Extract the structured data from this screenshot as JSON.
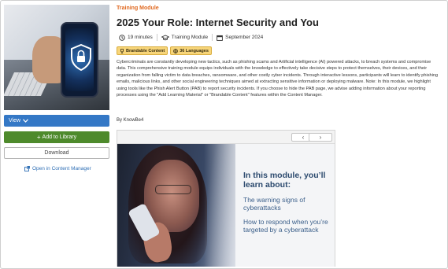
{
  "left": {
    "view_label": "View",
    "add_label": "Add to Library",
    "download_label": "Download",
    "open_label": "Open in Content Manager"
  },
  "header": {
    "category": "Training Module",
    "title": "2025 Your Role: Internet Security and You"
  },
  "meta": {
    "duration": "19 minutes",
    "type": "Training Module",
    "date": "September 2024"
  },
  "badges": {
    "brandable": "Brandable Content",
    "languages": "36 Languages"
  },
  "description": "Cybercriminals are constantly developing new tactics, such as phishing scams and Artificial intelligence (AI) powered attacks, to breach systems and compromise data. This comprehensive training module equips individuals with the knowledge to effectively take decisive steps to protect themselves, their devices, and their organization from falling victim to data breaches, ransomware, and other costly cyber incidents. Through interactive lessons, participants will learn to identify phishing emails, malicious links, and other social engineering techniques aimed at extracting sensitive information or deploying malware. Note: In this module, we highlight using tools like the Phish Alert Button (PAB) to report security incidents. If you choose to hide the PAB page, we advise adding information about your reporting processes using the \"Add Learning Material\" or \"Brandable Content\" features within the Content Manager.",
  "byline": "By KnowBe4",
  "viewer": {
    "prev": "‹",
    "next": "›",
    "slide_heading": "In this module, you’ll learn about:",
    "slide_point1": "The warning signs of cyberattacks",
    "slide_point2": "How to respond when you’re targeted by a cyberattack"
  },
  "colors": {
    "accent_orange": "#e0681f",
    "view_blue": "#3478c6",
    "add_green": "#4e8a2c",
    "badge_yellow": "#f7d57a",
    "link_blue": "#2f6fb5"
  }
}
